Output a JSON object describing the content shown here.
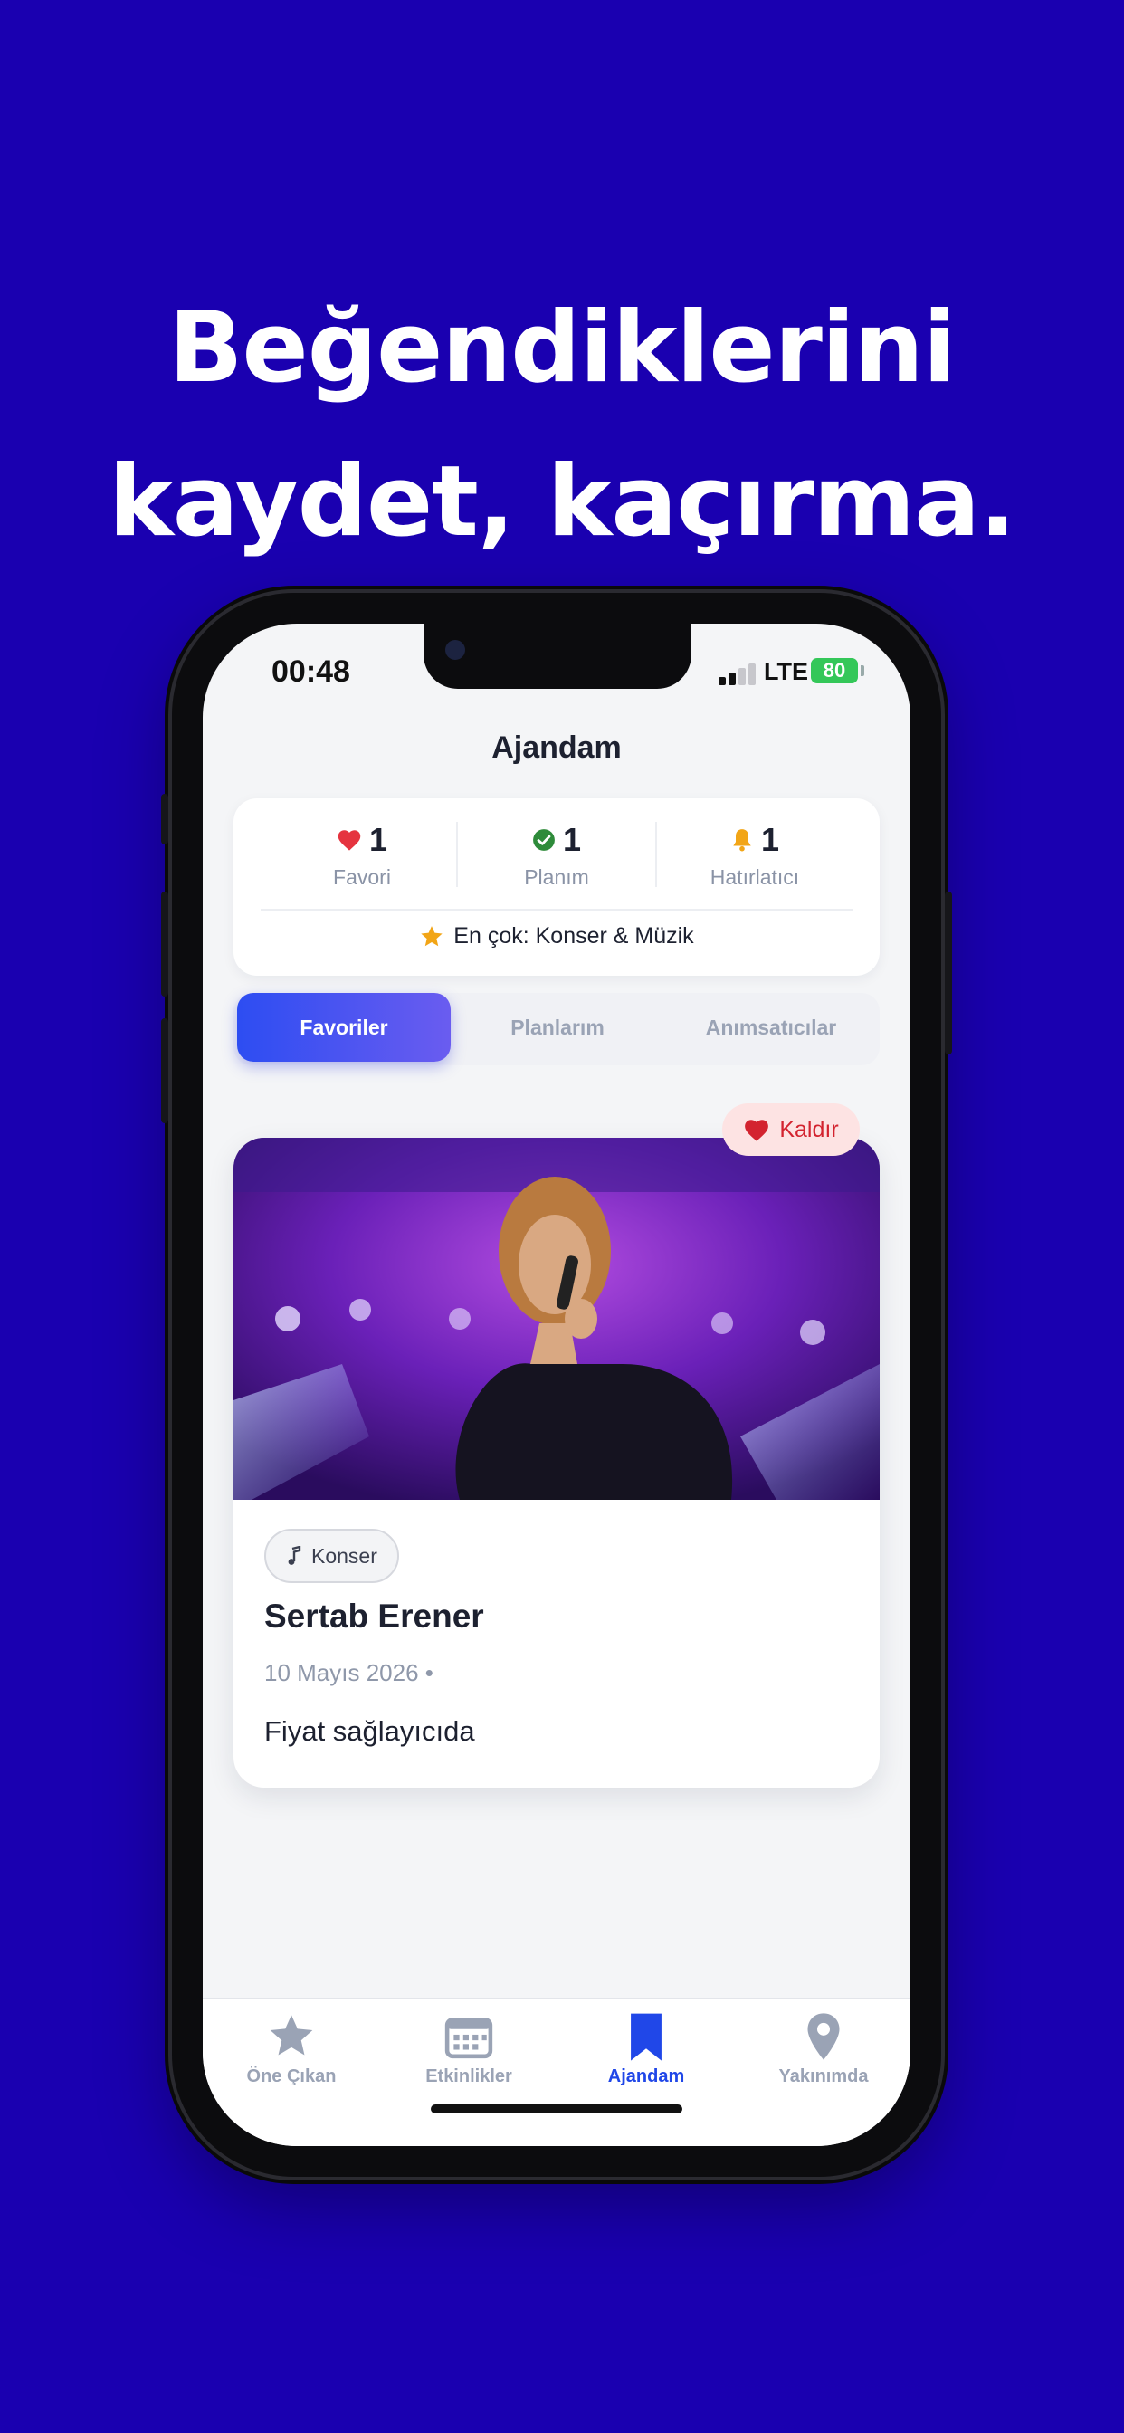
{
  "headline": {
    "line1": "Beğendiklerini",
    "line2": "kaydet, kaçırma."
  },
  "status_bar": {
    "time": "00:48",
    "network": "LTE",
    "battery": "80"
  },
  "page_title": "Ajandam",
  "stats": {
    "favorites": {
      "count": "1",
      "label": "Favori",
      "icon": "heart-icon",
      "color": "#e5343f"
    },
    "plans": {
      "count": "1",
      "label": "Planım",
      "icon": "check-circle-icon",
      "color": "#2e8b3a"
    },
    "reminders": {
      "count": "1",
      "label": "Hatırlatıcı",
      "icon": "bell-icon",
      "color": "#f2a516"
    },
    "most": "En çok: Konser & Müzik"
  },
  "tabs": [
    {
      "label": "Favoriler",
      "active": true
    },
    {
      "label": "Planlarım",
      "active": false
    },
    {
      "label": "Anımsatıcılar",
      "active": false
    }
  ],
  "event": {
    "remove_label": "Kaldır",
    "category": "Konser",
    "title": "Sertab Erener",
    "date": "10 Mayıs 2026 •",
    "price": "Fiyat sağlayıcıda"
  },
  "bottom_nav": [
    {
      "label": "Öne Çıkan",
      "icon": "star-icon"
    },
    {
      "label": "Etkinlikler",
      "icon": "calendar-icon"
    },
    {
      "label": "Ajandam",
      "icon": "bookmark-icon",
      "active": true
    },
    {
      "label": "Yakınımda",
      "icon": "location-pin-icon"
    }
  ],
  "colors": {
    "background": "#1a00b0",
    "accent": "#2047e8",
    "inactive": "#9aa3b5"
  }
}
